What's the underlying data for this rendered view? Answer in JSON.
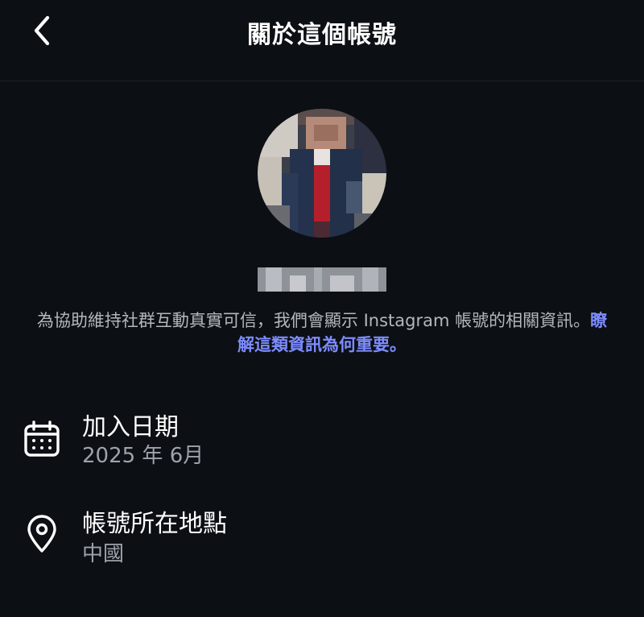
{
  "header": {
    "back_icon": "chevron-left-icon",
    "title": "關於這個帳號"
  },
  "profile": {
    "avatar_icon": "profile-avatar-pixelated",
    "username": "",
    "description_text": "為協助維持社群互動真實可信，我們會顯示 Instagram 帳號的相關資訊。",
    "description_link": "瞭解這類資訊為何重要。",
    "link_color": "#7d8cff"
  },
  "info": {
    "join_date": {
      "icon": "calendar-icon",
      "label": "加入日期",
      "value": "2025 年 6月"
    },
    "location": {
      "icon": "location-pin-icon",
      "label": "帳號所在地點",
      "value": "中國"
    }
  },
  "colors": {
    "background": "#0c0f14",
    "text_primary": "#ffffff",
    "text_secondary": "#9ea3ab"
  }
}
